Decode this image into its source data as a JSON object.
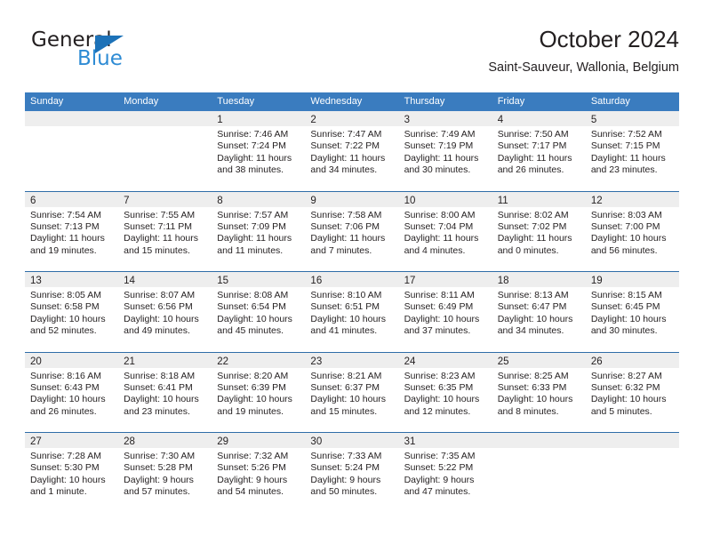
{
  "brand": {
    "name_top": "General",
    "name_bottom": "Blue",
    "triangle_color": "#1d72b8",
    "blue_color": "#2e8bd4"
  },
  "header": {
    "title": "October 2024",
    "subtitle": "Saint-Sauveur, Wallonia, Belgium"
  },
  "theme": {
    "header_row_bg": "#3a7cbf",
    "week_divider": "#2f6da8",
    "day_band_bg": "#eeeeee",
    "text": "#231f20"
  },
  "calendar": {
    "weekdays": [
      "Sunday",
      "Monday",
      "Tuesday",
      "Wednesday",
      "Thursday",
      "Friday",
      "Saturday"
    ],
    "weeks": [
      [
        {
          "day": "",
          "empty": true
        },
        {
          "day": "",
          "empty": true
        },
        {
          "day": "1",
          "sunrise": "Sunrise: 7:46 AM",
          "sunset": "Sunset: 7:24 PM",
          "daylight1": "Daylight: 11 hours",
          "daylight2": "and 38 minutes."
        },
        {
          "day": "2",
          "sunrise": "Sunrise: 7:47 AM",
          "sunset": "Sunset: 7:22 PM",
          "daylight1": "Daylight: 11 hours",
          "daylight2": "and 34 minutes."
        },
        {
          "day": "3",
          "sunrise": "Sunrise: 7:49 AM",
          "sunset": "Sunset: 7:19 PM",
          "daylight1": "Daylight: 11 hours",
          "daylight2": "and 30 minutes."
        },
        {
          "day": "4",
          "sunrise": "Sunrise: 7:50 AM",
          "sunset": "Sunset: 7:17 PM",
          "daylight1": "Daylight: 11 hours",
          "daylight2": "and 26 minutes."
        },
        {
          "day": "5",
          "sunrise": "Sunrise: 7:52 AM",
          "sunset": "Sunset: 7:15 PM",
          "daylight1": "Daylight: 11 hours",
          "daylight2": "and 23 minutes."
        }
      ],
      [
        {
          "day": "6",
          "sunrise": "Sunrise: 7:54 AM",
          "sunset": "Sunset: 7:13 PM",
          "daylight1": "Daylight: 11 hours",
          "daylight2": "and 19 minutes."
        },
        {
          "day": "7",
          "sunrise": "Sunrise: 7:55 AM",
          "sunset": "Sunset: 7:11 PM",
          "daylight1": "Daylight: 11 hours",
          "daylight2": "and 15 minutes."
        },
        {
          "day": "8",
          "sunrise": "Sunrise: 7:57 AM",
          "sunset": "Sunset: 7:09 PM",
          "daylight1": "Daylight: 11 hours",
          "daylight2": "and 11 minutes."
        },
        {
          "day": "9",
          "sunrise": "Sunrise: 7:58 AM",
          "sunset": "Sunset: 7:06 PM",
          "daylight1": "Daylight: 11 hours",
          "daylight2": "and 7 minutes."
        },
        {
          "day": "10",
          "sunrise": "Sunrise: 8:00 AM",
          "sunset": "Sunset: 7:04 PM",
          "daylight1": "Daylight: 11 hours",
          "daylight2": "and 4 minutes."
        },
        {
          "day": "11",
          "sunrise": "Sunrise: 8:02 AM",
          "sunset": "Sunset: 7:02 PM",
          "daylight1": "Daylight: 11 hours",
          "daylight2": "and 0 minutes."
        },
        {
          "day": "12",
          "sunrise": "Sunrise: 8:03 AM",
          "sunset": "Sunset: 7:00 PM",
          "daylight1": "Daylight: 10 hours",
          "daylight2": "and 56 minutes."
        }
      ],
      [
        {
          "day": "13",
          "sunrise": "Sunrise: 8:05 AM",
          "sunset": "Sunset: 6:58 PM",
          "daylight1": "Daylight: 10 hours",
          "daylight2": "and 52 minutes."
        },
        {
          "day": "14",
          "sunrise": "Sunrise: 8:07 AM",
          "sunset": "Sunset: 6:56 PM",
          "daylight1": "Daylight: 10 hours",
          "daylight2": "and 49 minutes."
        },
        {
          "day": "15",
          "sunrise": "Sunrise: 8:08 AM",
          "sunset": "Sunset: 6:54 PM",
          "daylight1": "Daylight: 10 hours",
          "daylight2": "and 45 minutes."
        },
        {
          "day": "16",
          "sunrise": "Sunrise: 8:10 AM",
          "sunset": "Sunset: 6:51 PM",
          "daylight1": "Daylight: 10 hours",
          "daylight2": "and 41 minutes."
        },
        {
          "day": "17",
          "sunrise": "Sunrise: 8:11 AM",
          "sunset": "Sunset: 6:49 PM",
          "daylight1": "Daylight: 10 hours",
          "daylight2": "and 37 minutes."
        },
        {
          "day": "18",
          "sunrise": "Sunrise: 8:13 AM",
          "sunset": "Sunset: 6:47 PM",
          "daylight1": "Daylight: 10 hours",
          "daylight2": "and 34 minutes."
        },
        {
          "day": "19",
          "sunrise": "Sunrise: 8:15 AM",
          "sunset": "Sunset: 6:45 PM",
          "daylight1": "Daylight: 10 hours",
          "daylight2": "and 30 minutes."
        }
      ],
      [
        {
          "day": "20",
          "sunrise": "Sunrise: 8:16 AM",
          "sunset": "Sunset: 6:43 PM",
          "daylight1": "Daylight: 10 hours",
          "daylight2": "and 26 minutes."
        },
        {
          "day": "21",
          "sunrise": "Sunrise: 8:18 AM",
          "sunset": "Sunset: 6:41 PM",
          "daylight1": "Daylight: 10 hours",
          "daylight2": "and 23 minutes."
        },
        {
          "day": "22",
          "sunrise": "Sunrise: 8:20 AM",
          "sunset": "Sunset: 6:39 PM",
          "daylight1": "Daylight: 10 hours",
          "daylight2": "and 19 minutes."
        },
        {
          "day": "23",
          "sunrise": "Sunrise: 8:21 AM",
          "sunset": "Sunset: 6:37 PM",
          "daylight1": "Daylight: 10 hours",
          "daylight2": "and 15 minutes."
        },
        {
          "day": "24",
          "sunrise": "Sunrise: 8:23 AM",
          "sunset": "Sunset: 6:35 PM",
          "daylight1": "Daylight: 10 hours",
          "daylight2": "and 12 minutes."
        },
        {
          "day": "25",
          "sunrise": "Sunrise: 8:25 AM",
          "sunset": "Sunset: 6:33 PM",
          "daylight1": "Daylight: 10 hours",
          "daylight2": "and 8 minutes."
        },
        {
          "day": "26",
          "sunrise": "Sunrise: 8:27 AM",
          "sunset": "Sunset: 6:32 PM",
          "daylight1": "Daylight: 10 hours",
          "daylight2": "and 5 minutes."
        }
      ],
      [
        {
          "day": "27",
          "sunrise": "Sunrise: 7:28 AM",
          "sunset": "Sunset: 5:30 PM",
          "daylight1": "Daylight: 10 hours",
          "daylight2": "and 1 minute."
        },
        {
          "day": "28",
          "sunrise": "Sunrise: 7:30 AM",
          "sunset": "Sunset: 5:28 PM",
          "daylight1": "Daylight: 9 hours",
          "daylight2": "and 57 minutes."
        },
        {
          "day": "29",
          "sunrise": "Sunrise: 7:32 AM",
          "sunset": "Sunset: 5:26 PM",
          "daylight1": "Daylight: 9 hours",
          "daylight2": "and 54 minutes."
        },
        {
          "day": "30",
          "sunrise": "Sunrise: 7:33 AM",
          "sunset": "Sunset: 5:24 PM",
          "daylight1": "Daylight: 9 hours",
          "daylight2": "and 50 minutes."
        },
        {
          "day": "31",
          "sunrise": "Sunrise: 7:35 AM",
          "sunset": "Sunset: 5:22 PM",
          "daylight1": "Daylight: 9 hours",
          "daylight2": "and 47 minutes."
        },
        {
          "day": "",
          "empty": true
        },
        {
          "day": "",
          "empty": true
        }
      ]
    ]
  }
}
